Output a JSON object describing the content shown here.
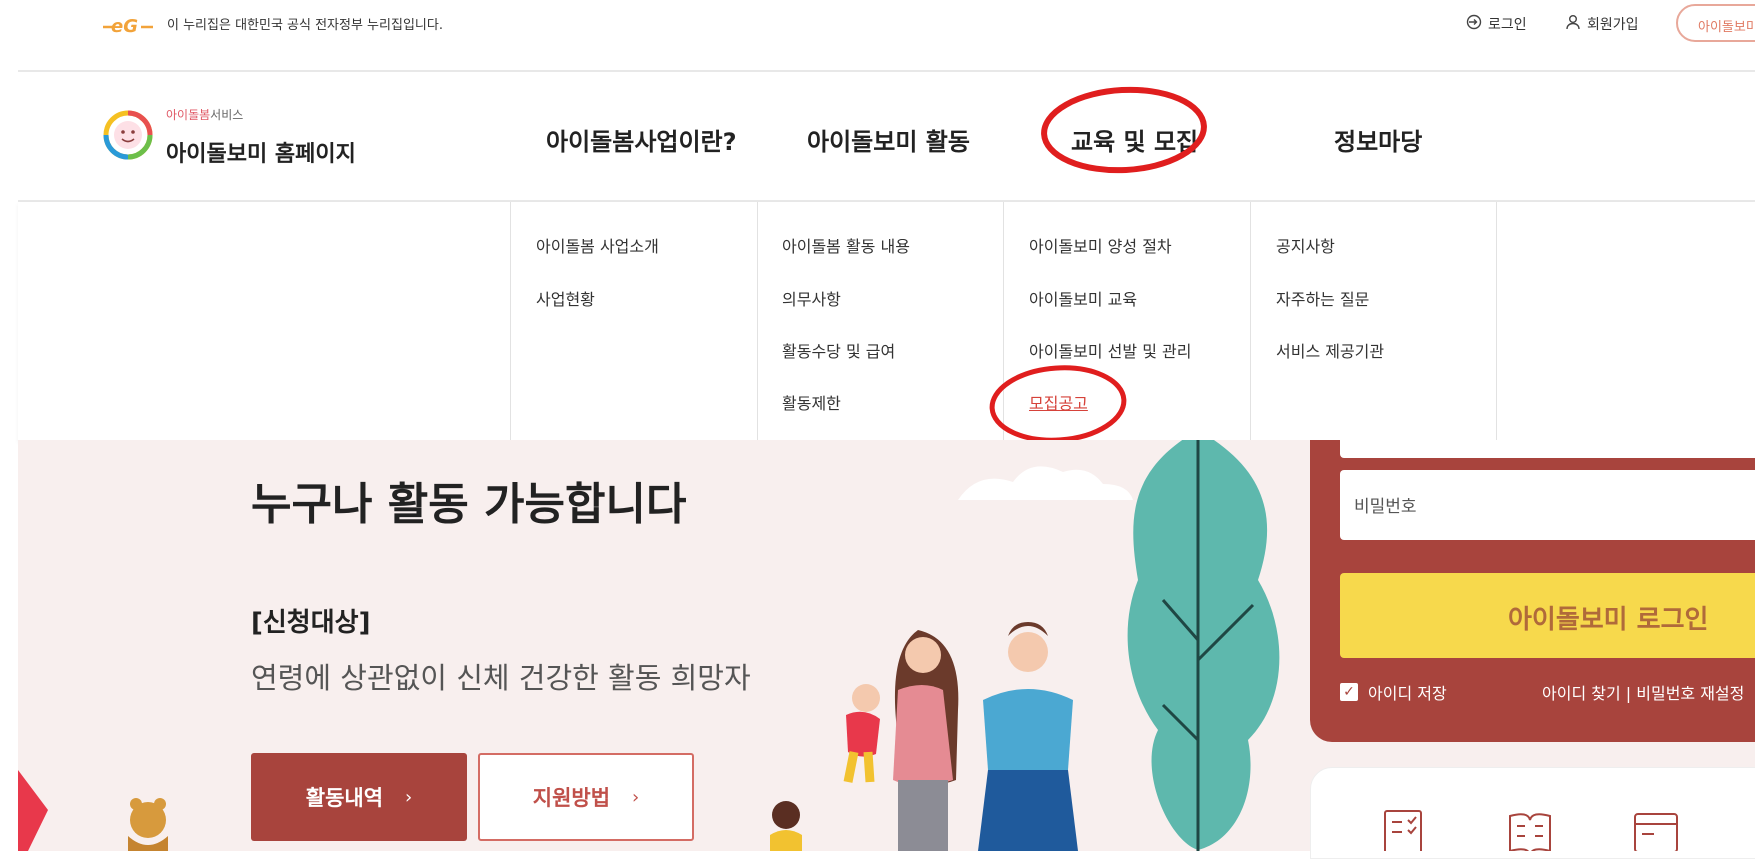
{
  "gov_bar": {
    "logo_text": "eG",
    "notice": "이 누리집은 대한민국 공식 전자정부 누리집입니다.",
    "login": "로그인",
    "join": "회원가입",
    "pill": "아이돌보미"
  },
  "header": {
    "logo_small_pink": "아이돌봄",
    "logo_small_gray": "서비스",
    "logo_title": "아이돌보미 홈페이지",
    "nav": [
      "아이돌봄사업이란?",
      "아이돌보미 활동",
      "교육 및 모집",
      "정보마당"
    ]
  },
  "dropdown": {
    "col1": [
      "아이돌봄 사업소개",
      "사업현황"
    ],
    "col2": [
      "아이돌봄 활동 내용",
      "의무사항",
      "활동수당 및 급여",
      "활동제한"
    ],
    "col3": [
      "아이돌보미 양성 절차",
      "아이돌보미 교육",
      "아이돌보미 선발 및 관리",
      "모집공고"
    ],
    "col4": [
      "공지사항",
      "자주하는 질문",
      "서비스 제공기관"
    ]
  },
  "hero": {
    "title": "누구나 활동 가능합니다",
    "target_label": "[신청대상]",
    "target_desc": "연령에 상관없이 신체 건강한 활동 희망자",
    "btn_activity": "활동내역",
    "btn_help": "지원방법"
  },
  "login": {
    "password_placeholder": "비밀번호",
    "login_button": "아이돌보미 로그인",
    "save_id": "아이디 저장",
    "find_links": "아이디 찾기 | 비밀번호 재설정"
  },
  "colors": {
    "brand": "#a8443d",
    "accent": "#f7d94c",
    "hero_bg": "#f8efee",
    "annotation": "#e01e1e"
  }
}
